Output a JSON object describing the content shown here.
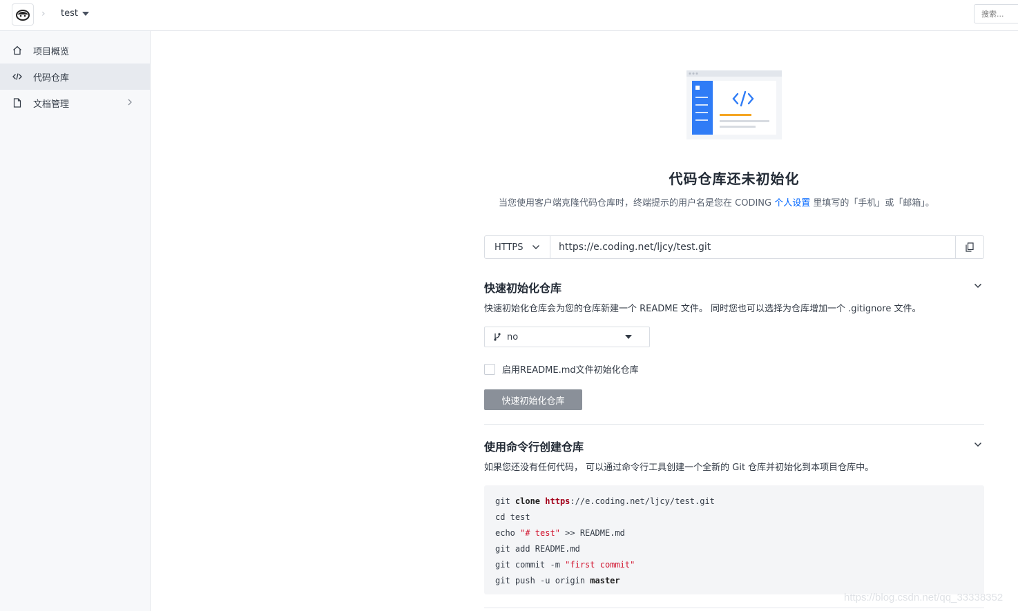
{
  "header": {
    "project_name": "test",
    "search_placeholder": "搜索..."
  },
  "sidebar": {
    "items": [
      {
        "label": "项目概览",
        "icon": "home-icon"
      },
      {
        "label": "代码仓库",
        "icon": "code-icon",
        "active": true
      },
      {
        "label": "文档管理",
        "icon": "document-icon",
        "has_submenu": true
      }
    ]
  },
  "empty_state": {
    "title": "代码仓库还未初始化",
    "desc_before": "当您使用客户端克隆代码仓库时，终端提示的用户名是您在 CODING ",
    "desc_link": "个人设置",
    "desc_after": " 里填写的「手机」或「邮箱」。"
  },
  "clone": {
    "protocol": "HTTPS",
    "url": "https://e.coding.net/ljcy/test.git"
  },
  "quick_init": {
    "title": "快速初始化仓库",
    "desc": "快速初始化仓库会为您的仓库新建一个 README 文件。 同时您也可以选择为仓库增加一个 .gitignore 文件。",
    "gitignore_value": "no",
    "readme_checkbox_label": "启用README.md文件初始化仓库",
    "readme_checked": false,
    "button_label": "快速初始化仓库"
  },
  "cli": {
    "title": "使用命令行创建仓库",
    "desc": "如果您还没有任何代码， 可以通过命令行工具创建一个全新的 Git 仓库并初始化到本项目仓库中。",
    "lines": [
      "git clone https://e.coding.net/ljcy/test.git",
      "cd test",
      "echo \"# test\" >> README.md",
      "git add README.md",
      "git commit -m \"first commit\"",
      "git push -u origin master"
    ]
  },
  "watermark": "https://blog.csdn.net/qq_33338352",
  "colors": {
    "accent": "#0066ff",
    "illustration_blue": "#2f7cf6",
    "illustration_orange": "#f5a623",
    "button_disabled": "#8a9099"
  }
}
